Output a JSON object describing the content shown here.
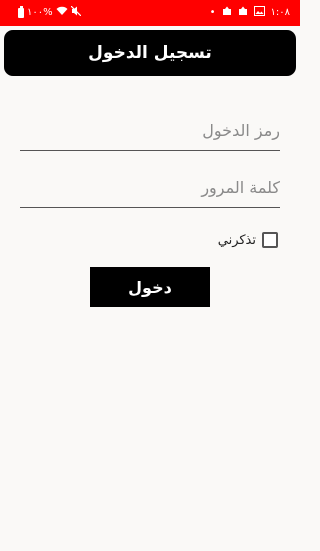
{
  "status_bar": {
    "time": "١:٠٨",
    "battery_percent": "١٠٠%",
    "background": "#FF0000"
  },
  "header": {
    "title": "تسجيل الدخول"
  },
  "form": {
    "username_placeholder": "رمز الدخول",
    "password_placeholder": "كلمة المرور",
    "remember_label": "تذكرني",
    "remember_checked": false,
    "login_label": "دخول"
  },
  "colors": {
    "accent": "#000000",
    "status_bar": "#FF0000",
    "background": "#FAF9F7"
  }
}
